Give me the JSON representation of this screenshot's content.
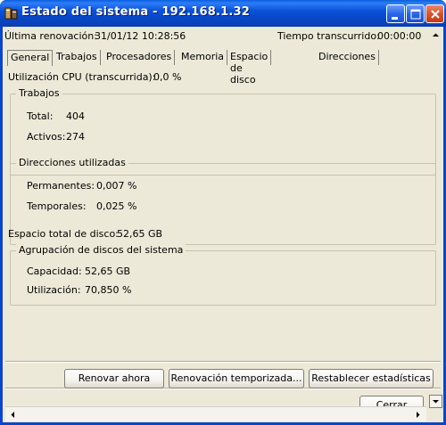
{
  "window": {
    "title": "Estado del sistema - 192.168.1.32"
  },
  "header": {
    "last_refresh_label": "Última renovación:",
    "last_refresh_value": "31/01/12 10:28:56",
    "elapsed_label": "Tiempo transcurrido:",
    "elapsed_value": "00:00:00"
  },
  "tabs": [
    {
      "label": "General"
    },
    {
      "label": "Trabajos"
    },
    {
      "label": "Procesadores"
    },
    {
      "label": "Memoria"
    },
    {
      "label": "Espacio de disco"
    },
    {
      "label": "Direcciones"
    }
  ],
  "general": {
    "cpu_label": "Utilización CPU (transcurrida):",
    "cpu_value": "0,0 %",
    "jobs": {
      "title": "Trabajos",
      "total_label": "Total:",
      "total_value": "404",
      "active_label": "Activos:",
      "active_value": "274"
    },
    "addresses": {
      "title": "Direcciones utilizadas",
      "permanent_label": "Permanentes:",
      "permanent_value": "0,007 %",
      "temporary_label": "Temporales:",
      "temporary_value": "0,025 %"
    },
    "disk_total_label": "Espacio total de disco:",
    "disk_total_value": "52,65 GB",
    "disk_pool": {
      "title": "Agrupación de discos del sistema",
      "capacity_label": "Capacidad:",
      "capacity_value": "52,65 GB",
      "usage_label": "Utilización:",
      "usage_value": "70,850 %"
    }
  },
  "buttons": {
    "refresh_now": "Renovar ahora",
    "timed_refresh": "Renovación temporizada...",
    "reset_stats": "Restablecer estadísticas",
    "close": "Cerrar"
  }
}
